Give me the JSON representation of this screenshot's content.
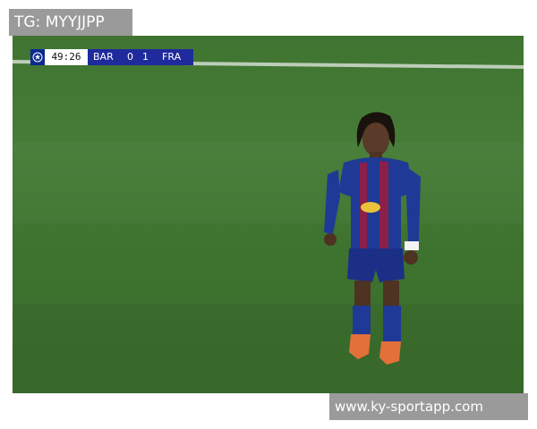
{
  "watermark_top": "TG: MYYJJPP",
  "watermark_bottom": "www.ky-sportapp.com",
  "scorebug": {
    "clock": "49:26",
    "home_team": "BAR",
    "home_score": "0",
    "away_score": "1",
    "away_team": "FRA",
    "logo_icon": "champions-league-star-icon"
  },
  "colors": {
    "pitch": "#3f7431",
    "scorebug_bar": "#1f2a9c",
    "kit_blue": "#1e3a96",
    "kit_maroon": "#8a1f4a"
  }
}
